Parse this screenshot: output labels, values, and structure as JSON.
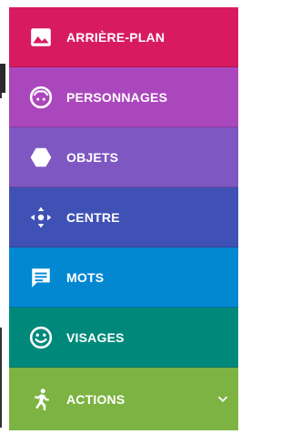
{
  "menu": {
    "items": [
      {
        "label": "ARRIÈRE-PLAN",
        "color": "#d81b60",
        "icon": "image-icon"
      },
      {
        "label": "PERSONNAGES",
        "color": "#ab47bc",
        "icon": "character-face-icon"
      },
      {
        "label": "OBJETS",
        "color": "#7e57c2",
        "icon": "hexagon-icon"
      },
      {
        "label": "CENTRE",
        "color": "#3f51b5",
        "icon": "move-arrows-icon"
      },
      {
        "label": "MOTS",
        "color": "#0288d1",
        "icon": "speech-bubble-icon"
      },
      {
        "label": "VISAGES",
        "color": "#00897b",
        "icon": "smiley-icon"
      },
      {
        "label": "ACTIONS",
        "color": "#7cb342",
        "icon": "running-person-icon",
        "expandable": true
      }
    ]
  }
}
